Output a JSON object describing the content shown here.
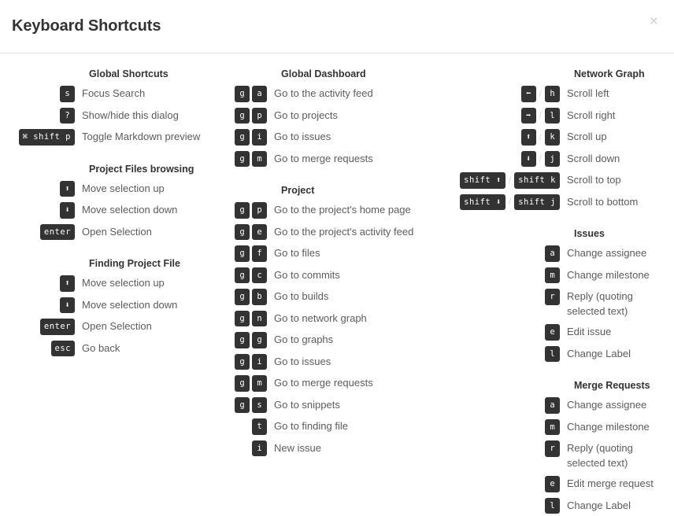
{
  "header": {
    "title": "Keyboard Shortcuts",
    "close_label": "×"
  },
  "separator": "/",
  "columns": [
    {
      "name": "column-left",
      "groups": [
        {
          "title": "Global Shortcuts",
          "rows": [
            {
              "keys": [
                [
                  "s"
                ]
              ],
              "desc": "Focus Search"
            },
            {
              "keys": [
                [
                  "?"
                ]
              ],
              "desc": "Show/hide this dialog"
            },
            {
              "keys": [
                [
                  "⌘ shift p"
                ]
              ],
              "desc": "Toggle Markdown preview"
            }
          ]
        },
        {
          "title": "Project Files browsing",
          "rows": [
            {
              "keys": [
                [
                  "⬆"
                ]
              ],
              "desc": "Move selection up"
            },
            {
              "keys": [
                [
                  "⬇"
                ]
              ],
              "desc": "Move selection down"
            },
            {
              "keys": [
                [
                  "enter"
                ]
              ],
              "desc": "Open Selection"
            }
          ]
        },
        {
          "title": "Finding Project File",
          "rows": [
            {
              "keys": [
                [
                  "⬆"
                ]
              ],
              "desc": "Move selection up"
            },
            {
              "keys": [
                [
                  "⬇"
                ]
              ],
              "desc": "Move selection down"
            },
            {
              "keys": [
                [
                  "enter"
                ]
              ],
              "desc": "Open Selection"
            },
            {
              "keys": [
                [
                  "esc"
                ]
              ],
              "desc": "Go back"
            }
          ]
        }
      ]
    },
    {
      "name": "column-middle",
      "groups": [
        {
          "title": "Global Dashboard",
          "rows": [
            {
              "keys": [
                [
                  "g",
                  "a"
                ]
              ],
              "desc": "Go to the activity feed"
            },
            {
              "keys": [
                [
                  "g",
                  "p"
                ]
              ],
              "desc": "Go to projects"
            },
            {
              "keys": [
                [
                  "g",
                  "i"
                ]
              ],
              "desc": "Go to issues"
            },
            {
              "keys": [
                [
                  "g",
                  "m"
                ]
              ],
              "desc": "Go to merge requests"
            }
          ]
        },
        {
          "title": "Project",
          "rows": [
            {
              "keys": [
                [
                  "g",
                  "p"
                ]
              ],
              "desc": "Go to the project's home page"
            },
            {
              "keys": [
                [
                  "g",
                  "e"
                ]
              ],
              "desc": "Go to the project's activity feed"
            },
            {
              "keys": [
                [
                  "g",
                  "f"
                ]
              ],
              "desc": "Go to files"
            },
            {
              "keys": [
                [
                  "g",
                  "c"
                ]
              ],
              "desc": "Go to commits"
            },
            {
              "keys": [
                [
                  "g",
                  "b"
                ]
              ],
              "desc": "Go to builds"
            },
            {
              "keys": [
                [
                  "g",
                  "n"
                ]
              ],
              "desc": "Go to network graph"
            },
            {
              "keys": [
                [
                  "g",
                  "g"
                ]
              ],
              "desc": "Go to graphs"
            },
            {
              "keys": [
                [
                  "g",
                  "i"
                ]
              ],
              "desc": "Go to issues"
            },
            {
              "keys": [
                [
                  "g",
                  "m"
                ]
              ],
              "desc": "Go to merge requests"
            },
            {
              "keys": [
                [
                  "g",
                  "s"
                ]
              ],
              "desc": "Go to snippets"
            },
            {
              "keys": [
                [
                  "t"
                ]
              ],
              "desc": "Go to finding file"
            },
            {
              "keys": [
                [
                  "i"
                ]
              ],
              "desc": "New issue"
            }
          ]
        }
      ]
    },
    {
      "name": "column-right",
      "groups": [
        {
          "title": "Network Graph",
          "rows": [
            {
              "keys": [
                [
                  "⬅"
                ],
                [
                  "h"
                ]
              ],
              "desc": "Scroll left"
            },
            {
              "keys": [
                [
                  "➡"
                ],
                [
                  "l"
                ]
              ],
              "desc": "Scroll right"
            },
            {
              "keys": [
                [
                  "⬆"
                ],
                [
                  "k"
                ]
              ],
              "desc": "Scroll up"
            },
            {
              "keys": [
                [
                  "⬇"
                ],
                [
                  "j"
                ]
              ],
              "desc": "Scroll down"
            },
            {
              "keys": [
                [
                  "shift ⬆"
                ],
                [
                  "shift k"
                ]
              ],
              "desc": "Scroll to top"
            },
            {
              "keys": [
                [
                  "shift ⬇"
                ],
                [
                  "shift j"
                ]
              ],
              "desc": "Scroll to bottom"
            }
          ]
        },
        {
          "title": "Issues",
          "rows": [
            {
              "keys": [
                [
                  "a"
                ]
              ],
              "desc": "Change assignee"
            },
            {
              "keys": [
                [
                  "m"
                ]
              ],
              "desc": "Change milestone"
            },
            {
              "keys": [
                [
                  "r"
                ]
              ],
              "desc": "Reply (quoting selected text)",
              "wrap": true
            },
            {
              "keys": [
                [
                  "e"
                ]
              ],
              "desc": "Edit issue"
            },
            {
              "keys": [
                [
                  "l"
                ]
              ],
              "desc": "Change Label"
            }
          ]
        },
        {
          "title": "Merge Requests",
          "rows": [
            {
              "keys": [
                [
                  "a"
                ]
              ],
              "desc": "Change assignee"
            },
            {
              "keys": [
                [
                  "m"
                ]
              ],
              "desc": "Change milestone"
            },
            {
              "keys": [
                [
                  "r"
                ]
              ],
              "desc": "Reply (quoting selected text)",
              "wrap": true
            },
            {
              "keys": [
                [
                  "e"
                ]
              ],
              "desc": "Edit merge request"
            },
            {
              "keys": [
                [
                  "l"
                ]
              ],
              "desc": "Change Label"
            }
          ]
        }
      ]
    }
  ]
}
